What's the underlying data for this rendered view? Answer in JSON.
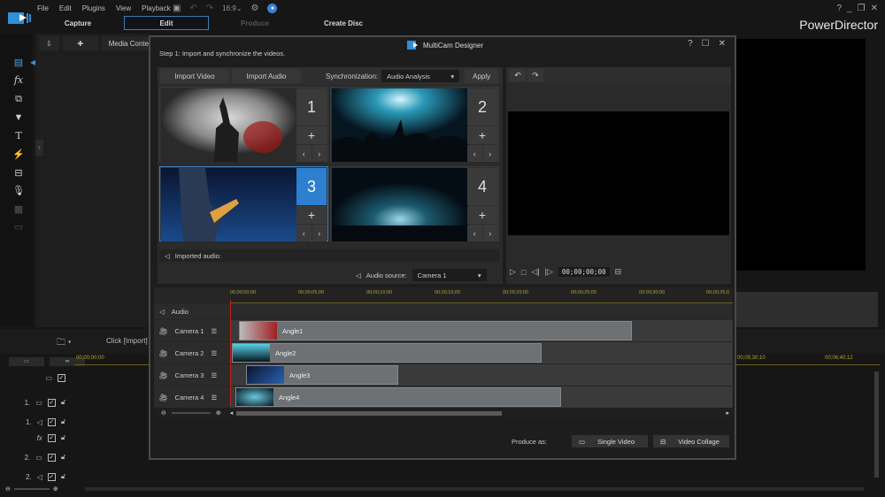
{
  "app": {
    "brand": "PowerDirector",
    "menu": [
      "File",
      "Edit",
      "Plugins",
      "View",
      "Playback"
    ],
    "toolbar_icons": [
      "save-icon",
      "undo-icon",
      "redo-icon",
      "aspect-ratio-icon",
      "settings-icon",
      "notification-icon"
    ],
    "window_controls": [
      "?",
      "_",
      "❐",
      "✕"
    ],
    "modes": [
      {
        "label": "Capture",
        "state": "normal"
      },
      {
        "label": "Edit",
        "state": "active"
      },
      {
        "label": "Produce",
        "state": "disabled"
      },
      {
        "label": "Create Disc",
        "state": "normal"
      }
    ],
    "accent": "#2d7fd0"
  },
  "library": {
    "tab_label": "Media Conten",
    "import_hint": "Click [Import]",
    "rail_icons": [
      "media-room-icon",
      "fx-icon",
      "pip-icon",
      "particle-icon",
      "title-icon",
      "transition-icon",
      "audio-mixing-icon",
      "voiceover-icon",
      "chapter-icon",
      "subtitle-icon"
    ]
  },
  "background_timeline": {
    "ruler": [
      "00;00;00;00",
      "00;05;30;10",
      "00;06;40;12"
    ],
    "tracks": [
      {
        "label": "",
        "icon": "video-track-icon"
      },
      {
        "label": "1.",
        "icon": "video-track-icon"
      },
      {
        "label": "1.",
        "icon": "audio-track-icon"
      },
      {
        "label": "",
        "icon": "fx-icon"
      },
      {
        "label": "2.",
        "icon": "video-track-icon"
      },
      {
        "label": "2.",
        "icon": "audio-track-icon"
      }
    ]
  },
  "dialog": {
    "title": "MultiCam Designer",
    "controls": [
      "?",
      "☐",
      "✕"
    ],
    "step": "Step 1: Import and synchronize the videos.",
    "import_video": "Import Video",
    "import_audio": "Import Audio",
    "sync_label": "Synchronization:",
    "sync_value": "Audio Analysis",
    "apply": "Apply",
    "cameras": [
      {
        "num": "1",
        "selected": false,
        "plus": "+",
        "prev": "‹",
        "next": "›"
      },
      {
        "num": "2",
        "selected": false,
        "plus": "+",
        "prev": "‹",
        "next": "›"
      },
      {
        "num": "3",
        "selected": true,
        "plus": "+",
        "prev": "‹",
        "next": "›"
      },
      {
        "num": "4",
        "selected": false,
        "plus": "+",
        "prev": "‹",
        "next": "›"
      }
    ],
    "imported_audio": "Imported audio:",
    "audio_source_label": "Audio source:",
    "audio_source_value": "Camera 1",
    "preview_timecode": "00;00;00;00",
    "ruler": [
      "00;00;00;00",
      "00;00;05;00",
      "00;00;10;00",
      "00;00;15;00",
      "00;00;20;00",
      "00;00;25;00",
      "00;00;30;00",
      "00;00;35;0"
    ],
    "tracks": [
      {
        "name": "Audio",
        "clip": ""
      },
      {
        "name": "Camera 1",
        "clip": "Angle1"
      },
      {
        "name": "Camera 2",
        "clip": "Angle2"
      },
      {
        "name": "Camera 3",
        "clip": "Angle3"
      },
      {
        "name": "Camera 4",
        "clip": "Angle4"
      }
    ],
    "produce_label": "Produce as:",
    "single_video": "Single Video",
    "video_collage": "Video Collage"
  }
}
